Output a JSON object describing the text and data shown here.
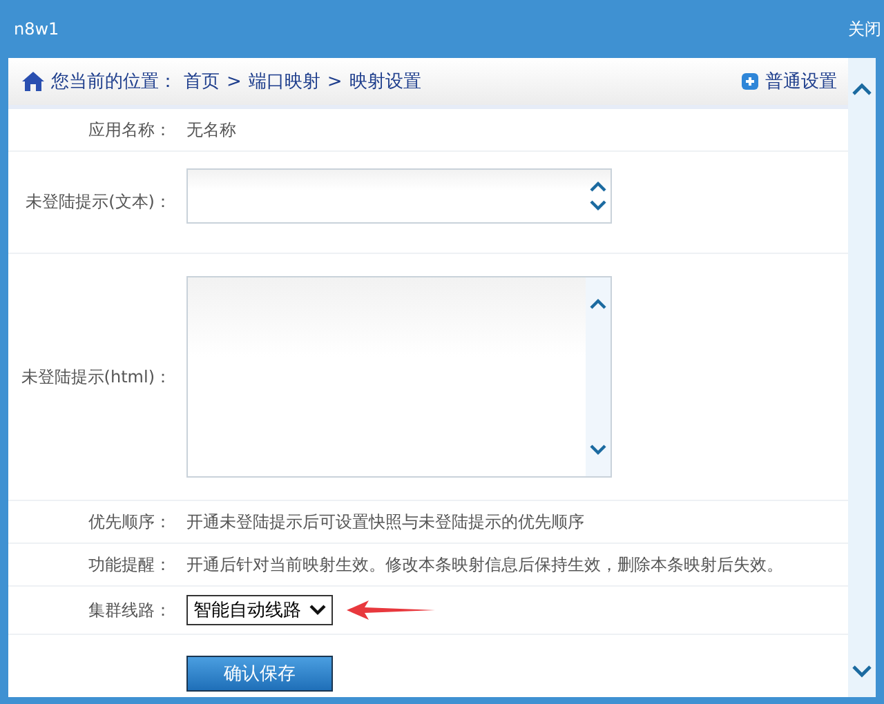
{
  "window": {
    "title": "n8w1",
    "close": "关闭"
  },
  "breadcrumb": {
    "label": "您当前的位置：",
    "items": [
      "首页",
      "端口映射",
      "映射设置"
    ],
    "separator": ">"
  },
  "header_action": "普通设置",
  "fields": [
    {
      "kind": "text",
      "label": "应用名称：",
      "value": "无名称"
    },
    {
      "kind": "textarea",
      "label": "未登陆提示(文本)："
    },
    {
      "kind": "textarea_large",
      "label": "未登陆提示(html)："
    },
    {
      "kind": "text",
      "label": "优先顺序：",
      "value": "开通未登陆提示后可设置快照与未登陆提示的优先顺序"
    },
    {
      "kind": "text",
      "label": "功能提醒：",
      "value": "开通后针对当前映射生效。修改本条映射信息后保持生效，删除本条映射后失效。"
    },
    {
      "kind": "select",
      "label": "集群线路：",
      "value": "智能自动线路"
    }
  ],
  "submit": "确认保存"
}
